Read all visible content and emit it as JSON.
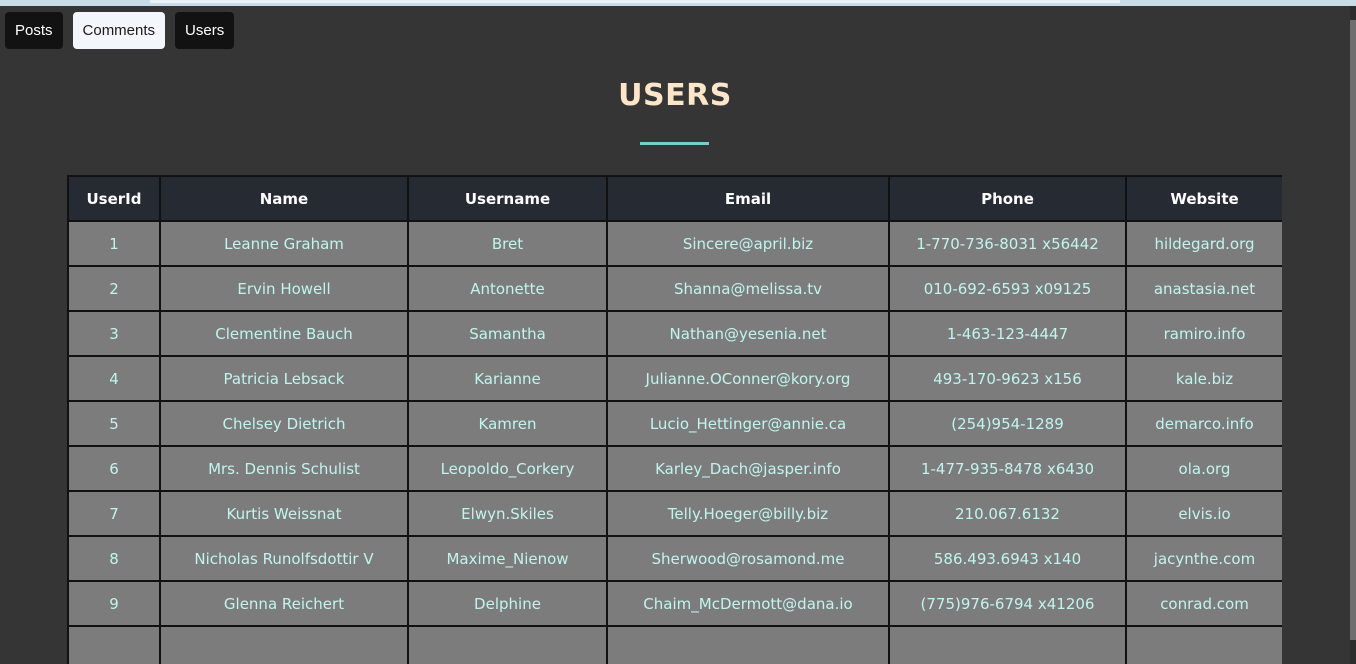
{
  "nav": {
    "posts": "Posts",
    "comments": "Comments",
    "users": "Users"
  },
  "page": {
    "title": "USERS"
  },
  "table": {
    "headers": [
      "UserId",
      "Name",
      "Username",
      "Email",
      "Phone",
      "Website"
    ],
    "rows": [
      [
        "1",
        "Leanne Graham",
        "Bret",
        "Sincere@april.biz",
        "1-770-736-8031 x56442",
        "hildegard.org"
      ],
      [
        "2",
        "Ervin Howell",
        "Antonette",
        "Shanna@melissa.tv",
        "010-692-6593 x09125",
        "anastasia.net"
      ],
      [
        "3",
        "Clementine Bauch",
        "Samantha",
        "Nathan@yesenia.net",
        "1-463-123-4447",
        "ramiro.info"
      ],
      [
        "4",
        "Patricia Lebsack",
        "Karianne",
        "Julianne.OConner@kory.org",
        "493-170-9623 x156",
        "kale.biz"
      ],
      [
        "5",
        "Chelsey Dietrich",
        "Kamren",
        "Lucio_Hettinger@annie.ca",
        "(254)954-1289",
        "demarco.info"
      ],
      [
        "6",
        "Mrs. Dennis Schulist",
        "Leopoldo_Corkery",
        "Karley_Dach@jasper.info",
        "1-477-935-8478 x6430",
        "ola.org"
      ],
      [
        "7",
        "Kurtis Weissnat",
        "Elwyn.Skiles",
        "Telly.Hoeger@billy.biz",
        "210.067.6132",
        "elvis.io"
      ],
      [
        "8",
        "Nicholas Runolfsdottir V",
        "Maxime_Nienow",
        "Sherwood@rosamond.me",
        "586.493.6943 x140",
        "jacynthe.com"
      ],
      [
        "9",
        "Glenna Reichert",
        "Delphine",
        "Chaim_McDermott@dana.io",
        "(775)976-6794 x41206",
        "conrad.com"
      ],
      [
        "",
        "",
        "",
        "",
        "",
        ""
      ]
    ]
  },
  "colors": {
    "background": "#353535",
    "title": "#fde6c8",
    "accent": "#6fd0cf",
    "header_bg": "#262a33",
    "cell_bg": "#7c7c7c",
    "cell_text": "#bff5ef"
  }
}
